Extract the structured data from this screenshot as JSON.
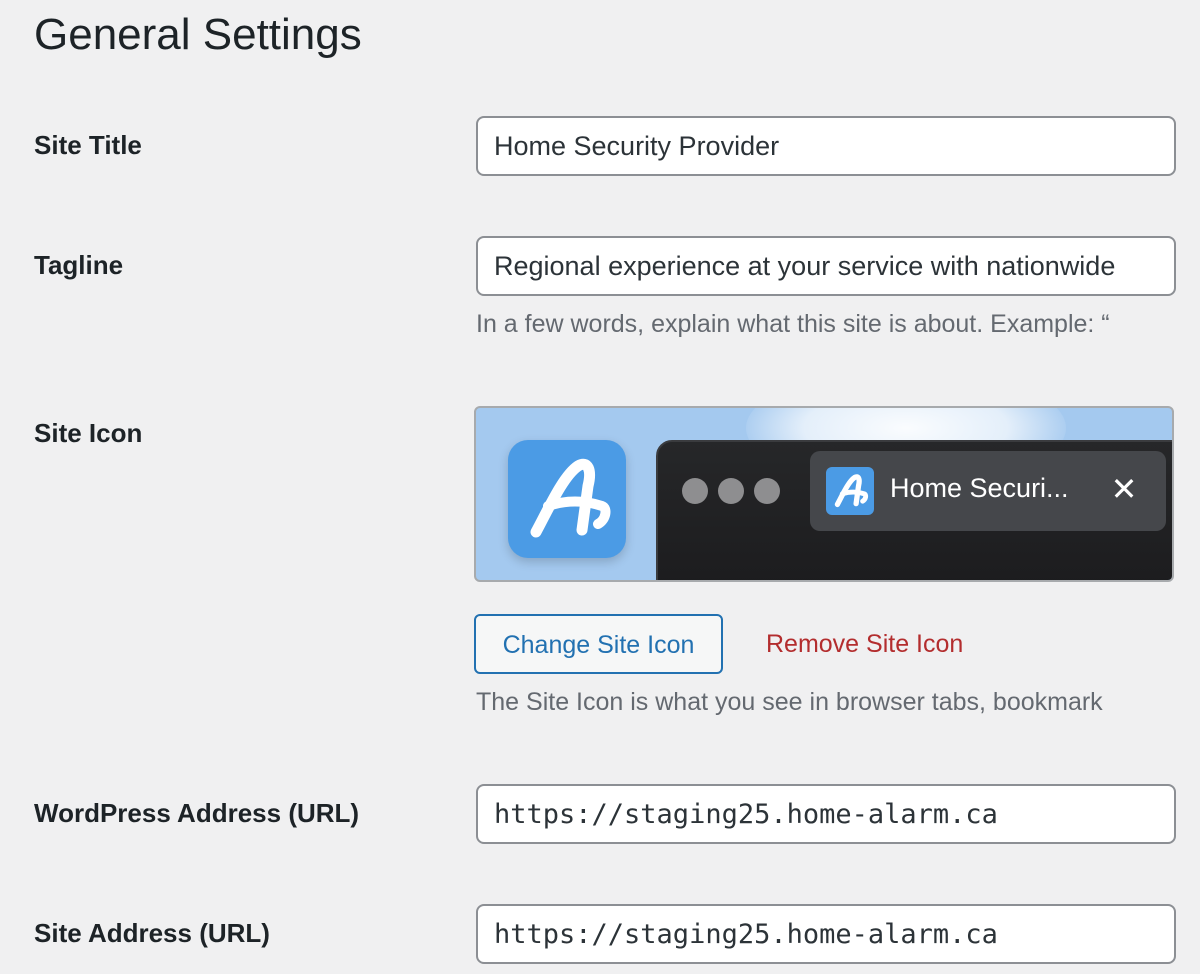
{
  "page": {
    "title": "General Settings"
  },
  "fields": {
    "site_title": {
      "label": "Site Title",
      "value": "Home Security Provider"
    },
    "tagline": {
      "label": "Tagline",
      "value": "Regional experience at your service with nationwide",
      "description": "In a few words, explain what this site is about. Example: “"
    },
    "site_icon": {
      "label": "Site Icon",
      "preview_tab_title": "Home Securi...",
      "preview_close_glyph": "✕",
      "preview_icon": "script-a-logo-icon",
      "preview_icon_color": "#4b9be5",
      "change_button": "Change Site Icon",
      "remove_link": "Remove Site Icon",
      "description": "The Site Icon is what you see in browser tabs, bookmark"
    },
    "wordpress_address": {
      "label": "WordPress Address (URL)",
      "value": "https://staging25.home-alarm.ca"
    },
    "site_address": {
      "label": "Site Address (URL)",
      "value": "https://staging25.home-alarm.ca"
    }
  },
  "colors": {
    "background": "#f0f0f1",
    "link_blue": "#2271b1",
    "danger_red": "#b32d2e",
    "muted_text": "#646970"
  }
}
